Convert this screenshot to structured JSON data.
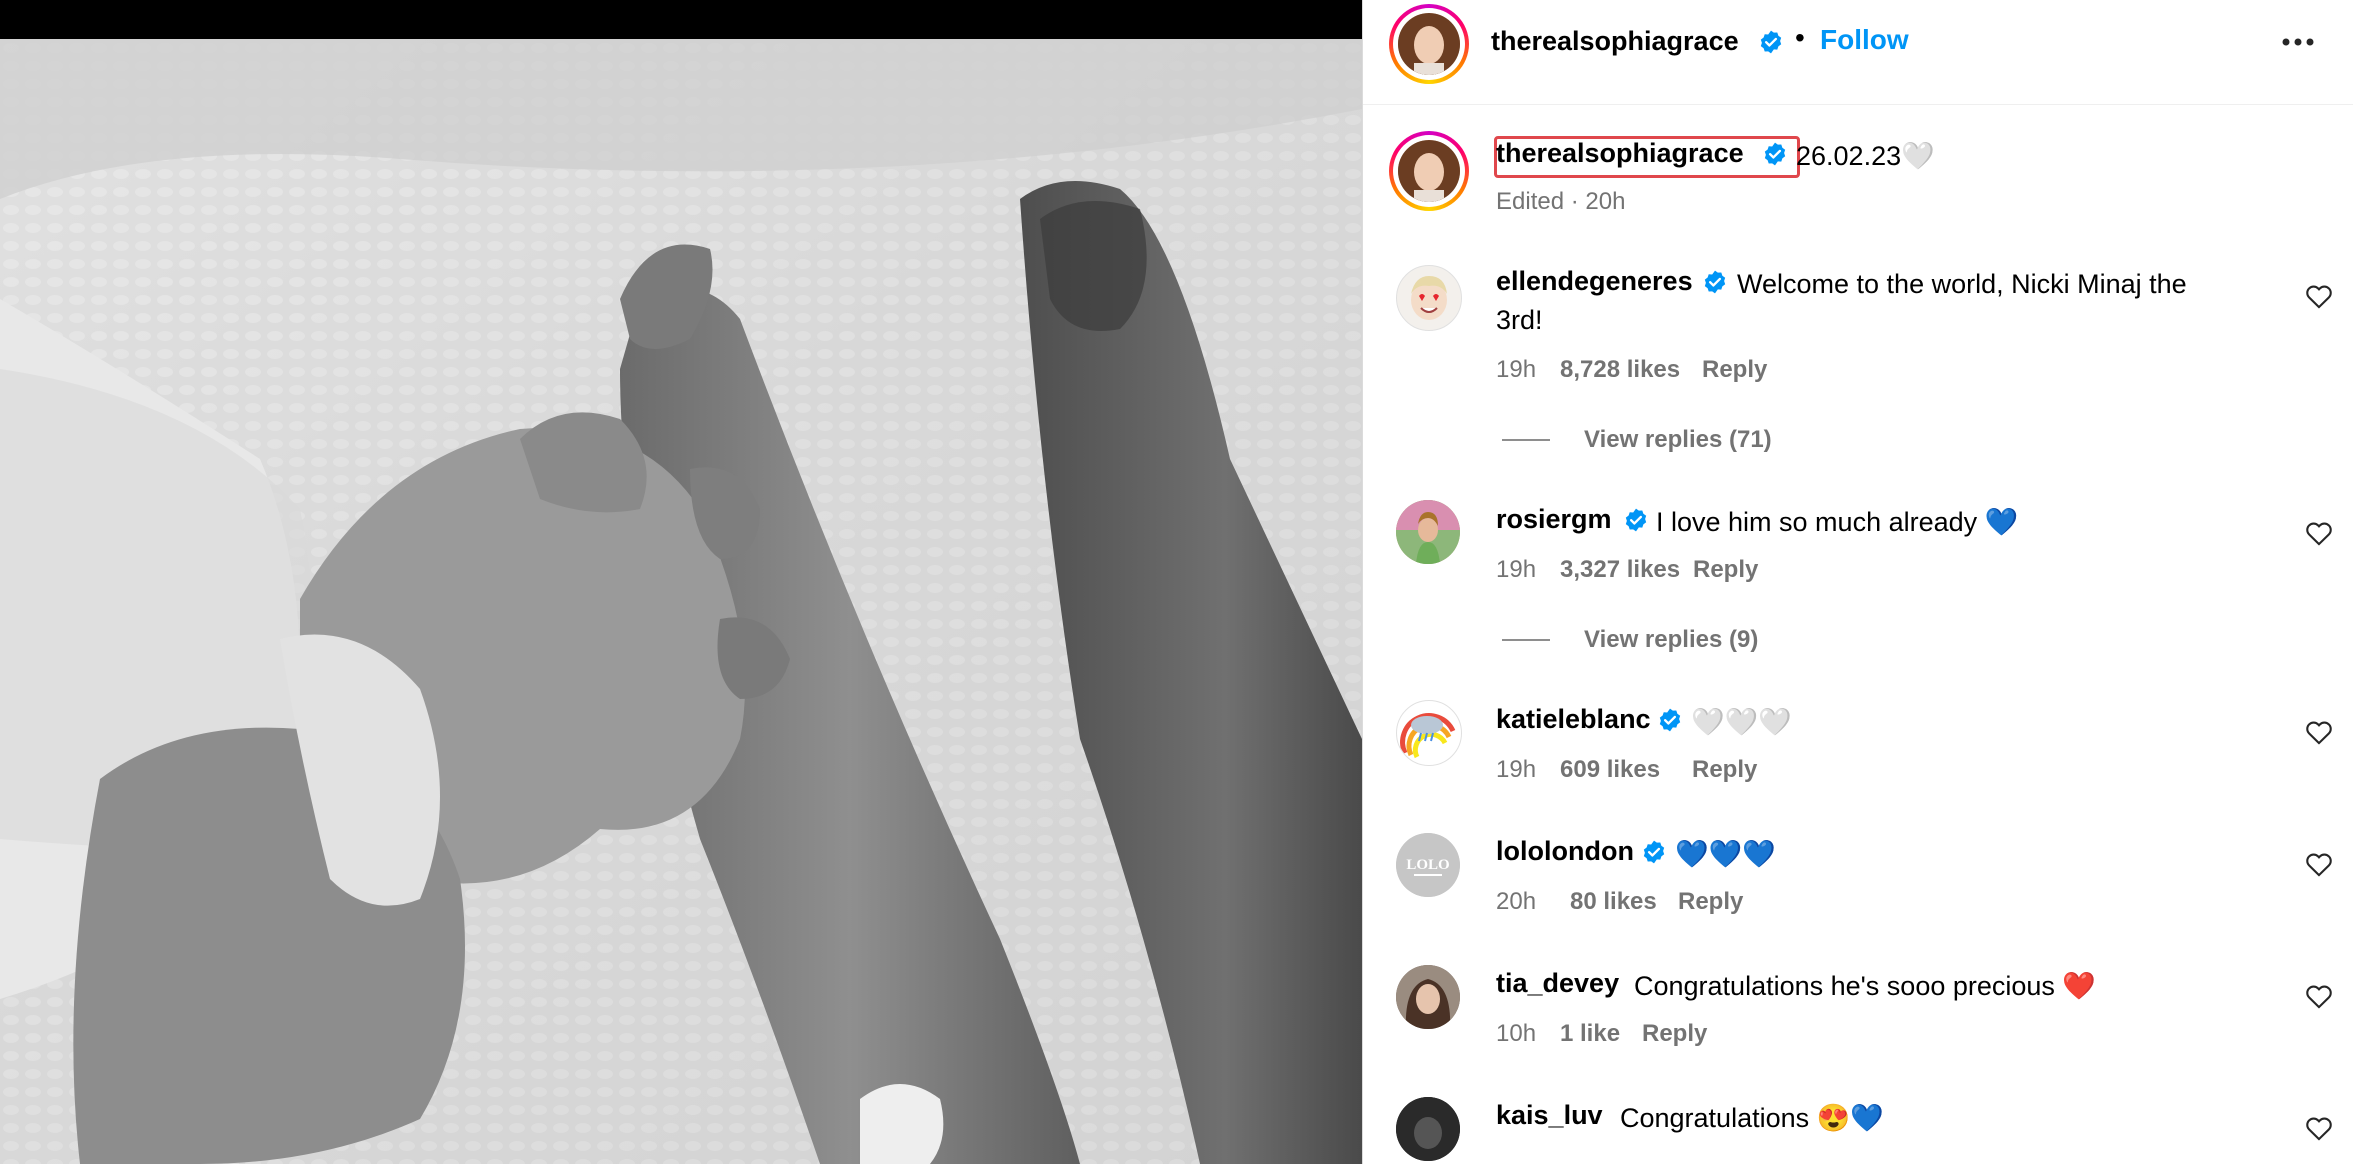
{
  "post": {
    "author": "therealsophiagrace",
    "follow_label": "Follow",
    "separator": "•",
    "caption_user": "therealsophiagrace",
    "caption_text": "26.02.23🤍",
    "edited": "Edited · 20h"
  },
  "comments": [
    {
      "user": "ellendegeneres",
      "verified": true,
      "text_line1": "Welcome to the world, Nicki Minaj the",
      "text_line2": "3rd!",
      "time": "19h",
      "likes": "8,728 likes",
      "reply": "Reply",
      "view_replies": "View replies (71)",
      "avatar": "emoji-heart-eyes-avatar"
    },
    {
      "user": "rosiergm",
      "verified": true,
      "text_line1": "I love him so much already 💙",
      "time": "19h",
      "likes": "3,327 likes",
      "reply": "Reply",
      "view_replies": "View replies (9)",
      "avatar": "photo-avatar"
    },
    {
      "user": "katieleblanc",
      "verified": true,
      "text_line1": "🤍🤍🤍",
      "time": "19h",
      "likes": "609 likes",
      "reply": "Reply",
      "avatar": "rainbow-cloud-avatar"
    },
    {
      "user": "lololondon",
      "verified": true,
      "text_line1": "💙💙💙",
      "time": "20h",
      "likes": "80 likes",
      "reply": "Reply",
      "avatar": "lolo-logo-avatar",
      "avatar_text": "LOLO"
    },
    {
      "user": "tia_devey",
      "verified": false,
      "text_line1": "Congratulations he's sooo precious ❤️",
      "time": "10h",
      "likes": "1 like",
      "reply": "Reply",
      "avatar": "photo-avatar"
    },
    {
      "user": "kais_luv",
      "verified": false,
      "text_line1": "Congratulations 😍💙",
      "avatar": "photo-avatar"
    }
  ],
  "colors": {
    "accent": "#0095f6",
    "verified": "#0095f6",
    "highlight_box": "#e0474c",
    "meta_gray": "#737373"
  },
  "icons": [
    "verified-badge-icon",
    "more-options-icon",
    "heart-icon"
  ]
}
